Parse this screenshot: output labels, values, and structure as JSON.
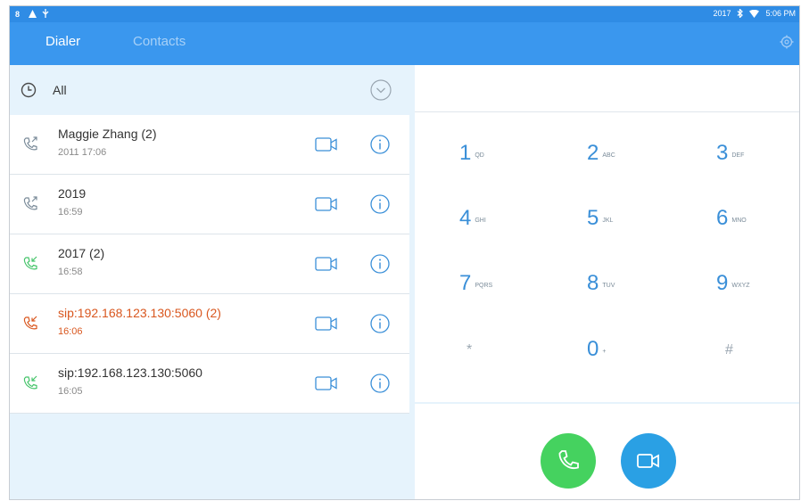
{
  "status_bar": {
    "left_icons": [
      "notification-icon",
      "warning-icon",
      "usb-icon"
    ],
    "right_text": "2017",
    "right_icons": [
      "bluetooth-icon",
      "wifi-icon"
    ],
    "time": "5:06 PM"
  },
  "tabs": [
    {
      "label": "Dialer",
      "active": true
    },
    {
      "label": "Contacts",
      "active": false
    }
  ],
  "filter": {
    "label": "All"
  },
  "calls": [
    {
      "name": "Maggie Zhang (2)",
      "time": "2011 17:06",
      "type": "outgoing"
    },
    {
      "name": "2019",
      "time": "16:59",
      "type": "outgoing"
    },
    {
      "name": "2017 (2)",
      "time": "16:58",
      "type": "incoming"
    },
    {
      "name": "sip:192.168.123.130:5060 (2)",
      "time": "16:06",
      "type": "missed"
    },
    {
      "name": "sip:192.168.123.130:5060",
      "time": "16:05",
      "type": "incoming"
    }
  ],
  "keypad": [
    {
      "digit": "1",
      "letters": "QD"
    },
    {
      "digit": "2",
      "letters": "ABC"
    },
    {
      "digit": "3",
      "letters": "DEF"
    },
    {
      "digit": "4",
      "letters": "GHI"
    },
    {
      "digit": "5",
      "letters": "JKL"
    },
    {
      "digit": "6",
      "letters": "MNO"
    },
    {
      "digit": "7",
      "letters": "PQRS"
    },
    {
      "digit": "8",
      "letters": "TUV"
    },
    {
      "digit": "9",
      "letters": "WXYZ"
    },
    {
      "digit": "*",
      "letters": ""
    },
    {
      "digit": "0",
      "letters": "+"
    },
    {
      "digit": "#",
      "letters": ""
    }
  ],
  "colors": {
    "statusbar": "#2f8ce5",
    "appbar": "#3a97ee",
    "outgoing": "#7a8b99",
    "incoming": "#45c46a",
    "missed": "#d9571f",
    "call_button": "#45d25f",
    "video_button": "#2aa0e4",
    "accent": "#3a8fd8"
  }
}
